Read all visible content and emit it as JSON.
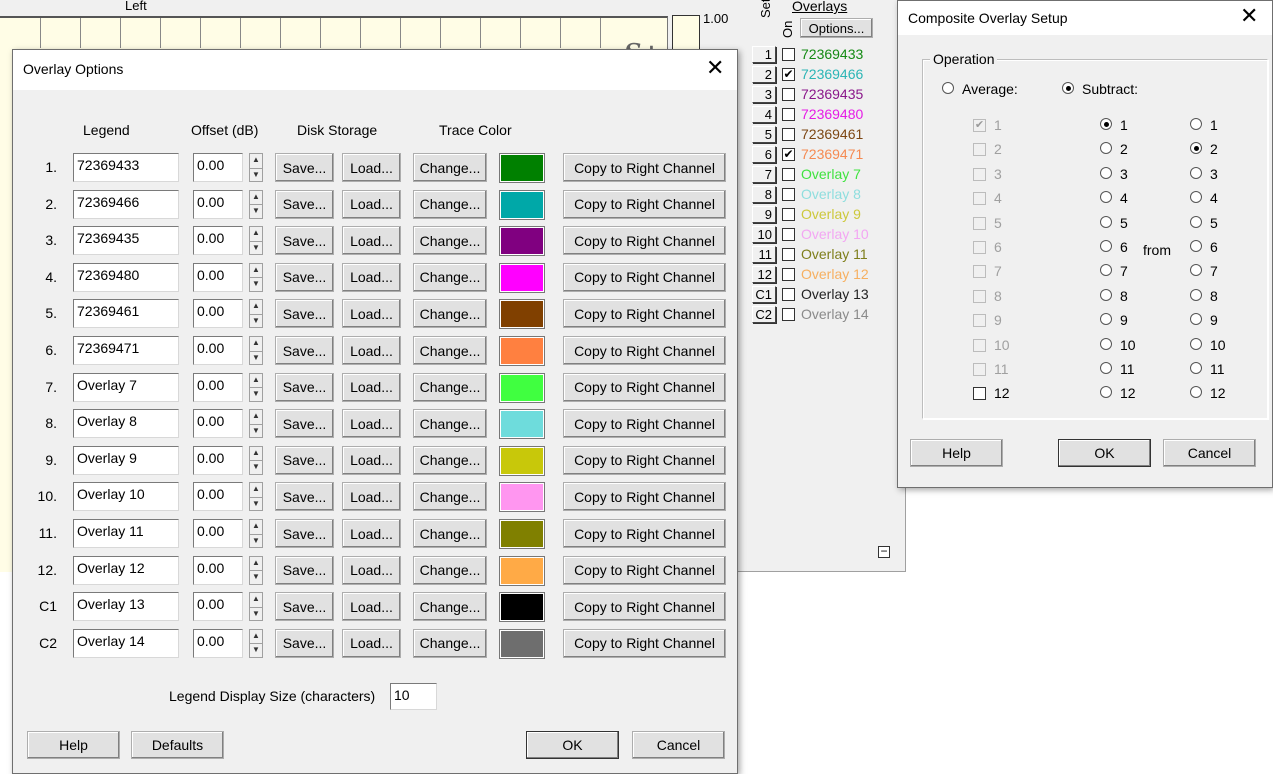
{
  "background": {
    "plot_title": "Left",
    "plot_badge": "S+",
    "scale_label": "1.00",
    "set_label": "Set",
    "on_label": "On",
    "overlays_title": "Overlays",
    "options_label": "Options...",
    "overlays": [
      {
        "num": "1",
        "checked": false,
        "name": "72369433",
        "color": "#138a13"
      },
      {
        "num": "2",
        "checked": true,
        "name": "72369466",
        "color": "#2bb5b5"
      },
      {
        "num": "3",
        "checked": false,
        "name": "72369435",
        "color": "#8a168a"
      },
      {
        "num": "4",
        "checked": false,
        "name": "72369480",
        "color": "#e61ae6"
      },
      {
        "num": "5",
        "checked": false,
        "name": "72369461",
        "color": "#7d4613"
      },
      {
        "num": "6",
        "checked": true,
        "name": "72369471",
        "color": "#f58a52"
      },
      {
        "num": "7",
        "checked": false,
        "name": "Overlay 7",
        "color": "#3fe33f"
      },
      {
        "num": "8",
        "checked": false,
        "name": "Overlay 8",
        "color": "#8fdede"
      },
      {
        "num": "9",
        "checked": false,
        "name": "Overlay 9",
        "color": "#cdc83b"
      },
      {
        "num": "10",
        "checked": false,
        "name": "Overlay 10",
        "color": "#f3a6f3"
      },
      {
        "num": "11",
        "checked": false,
        "name": "Overlay 11",
        "color": "#7e7e1a"
      },
      {
        "num": "12",
        "checked": false,
        "name": "Overlay 12",
        "color": "#f6b060"
      },
      {
        "num": "C1",
        "checked": false,
        "name": "Overlay 13",
        "color": "#222222"
      },
      {
        "num": "C2",
        "checked": false,
        "name": "Overlay 14",
        "color": "#8a8a8a"
      }
    ],
    "collapse_icon": "minus-box-icon"
  },
  "overlay_options": {
    "title": "Overlay Options",
    "close_glyph": "✕",
    "headers": {
      "legend": "Legend",
      "offset": "Offset (dB)",
      "disk": "Disk Storage",
      "trace": "Trace Color"
    },
    "save_label": "Save...",
    "load_label": "Load...",
    "change_label": "Change...",
    "copy_label": "Copy to Right Channel",
    "rows": [
      {
        "idx": "1.",
        "legend": "72369433",
        "offset": "0.00",
        "color": "#008000"
      },
      {
        "idx": "2.",
        "legend": "72369466",
        "offset": "0.00",
        "color": "#00a8a8"
      },
      {
        "idx": "3.",
        "legend": "72369435",
        "offset": "0.00",
        "color": "#800080"
      },
      {
        "idx": "4.",
        "legend": "72369480",
        "offset": "0.00",
        "color": "#ff00ff"
      },
      {
        "idx": "5.",
        "legend": "72369461",
        "offset": "0.00",
        "color": "#804000"
      },
      {
        "idx": "6.",
        "legend": "72369471",
        "offset": "0.00",
        "color": "#ff8040"
      },
      {
        "idx": "7.",
        "legend": "Overlay 7",
        "offset": "0.00",
        "color": "#40ff40"
      },
      {
        "idx": "8.",
        "legend": "Overlay 8",
        "offset": "0.00",
        "color": "#6edcdc"
      },
      {
        "idx": "9.",
        "legend": "Overlay 9",
        "offset": "0.00",
        "color": "#c8c80a"
      },
      {
        "idx": "10.",
        "legend": "Overlay 10",
        "offset": "0.00",
        "color": "#ff96f0"
      },
      {
        "idx": "11.",
        "legend": "Overlay 11",
        "offset": "0.00",
        "color": "#808000"
      },
      {
        "idx": "12.",
        "legend": "Overlay 12",
        "offset": "0.00",
        "color": "#ffaa46"
      },
      {
        "idx": "C1",
        "legend": "Overlay 13",
        "offset": "0.00",
        "color": "#000000"
      },
      {
        "idx": "C2",
        "legend": "Overlay 14",
        "offset": "0.00",
        "color": "#6e6e6e"
      }
    ],
    "legend_size_label": "Legend Display Size (characters)",
    "legend_size_value": "10",
    "help_label": "Help",
    "defaults_label": "Defaults",
    "ok_label": "OK",
    "cancel_label": "Cancel"
  },
  "composite": {
    "title": "Composite Overlay Setup",
    "close_glyph": "✕",
    "operation_label": "Operation",
    "average_label": "Average:",
    "subtract_label": "Subtract:",
    "average_selected": false,
    "subtract_selected": true,
    "from_label": "from",
    "items": [
      {
        "label": "1",
        "checked": true
      },
      {
        "label": "2",
        "checked": false
      },
      {
        "label": "3",
        "checked": false
      },
      {
        "label": "4",
        "checked": false
      },
      {
        "label": "5",
        "checked": false
      },
      {
        "label": "6",
        "checked": false
      },
      {
        "label": "7",
        "checked": false
      },
      {
        "label": "8",
        "checked": false
      },
      {
        "label": "9",
        "checked": false
      },
      {
        "label": "10",
        "checked": false
      },
      {
        "label": "11",
        "checked": false
      },
      {
        "label": "12",
        "checked": false
      }
    ],
    "average_enabled_count": 1,
    "subtract_a_selected": "1",
    "subtract_b_selected": "2",
    "help_label": "Help",
    "ok_label": "OK",
    "cancel_label": "Cancel"
  }
}
